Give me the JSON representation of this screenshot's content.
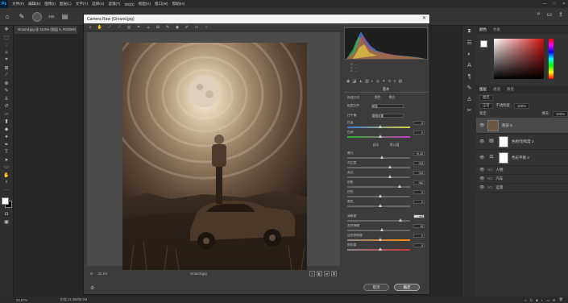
{
  "app": {
    "logo": "Ps"
  },
  "menu": [
    "文件(F)",
    "编辑(E)",
    "图像(I)",
    "图层(L)",
    "文字(Y)",
    "选择(S)",
    "滤镜(T)",
    "3D(D)",
    "视图(V)",
    "窗口(W)",
    "帮助(H)"
  ],
  "options": {
    "brush_size": "495"
  },
  "document": {
    "tab": "Ground.jpg @ 33.6% (图层 5, RGB/8#)"
  },
  "status": {
    "zoom": "33.57%",
    "doc": "文档:14.3M/86.5M"
  },
  "dialog": {
    "title": "Camera Raw (Ground.jpg)",
    "zoom": "31.1%",
    "filename": "Ground.jpg",
    "cancel_label": "取消",
    "ok_label": "确定",
    "basic_label": "基本",
    "white_balance_label": "白平衡:",
    "white_balance_value": "原照设置",
    "temperature_label": "色温",
    "temperature_value": "0",
    "tint_label": "色调",
    "tint_value": "0",
    "auto_label": "自动",
    "default_label": "默认值",
    "exposure_label": "曝光",
    "exposure_value": "+0.29",
    "contrast_label": "对比度",
    "contrast_value": "+33",
    "highlights_label": "高光",
    "highlights_value": "+33",
    "shadows_label": "阴影",
    "shadows_value": "+62",
    "whites_label": "白色",
    "whites_value": "0",
    "blacks_label": "黑色",
    "blacks_value": "0",
    "texture_label": "清晰度",
    "texture_value": "+64",
    "dehaze_label": "去除薄雾",
    "dehaze_value": "+6",
    "vibrance_label": "自然饱和度",
    "vibrance_value": "0",
    "saturation_label": "饱和度",
    "saturation_value": "0",
    "profile_label": "配置文件:",
    "profile_value": "颜色",
    "treatment_label": "处理方式:",
    "treatment_color": "颜色",
    "treatment_bw": "黑白"
  },
  "panels": {
    "color_tab": "颜色",
    "swatch_tab": "色板",
    "layers_tab": "图层",
    "channels_tab": "通道",
    "paths_tab": "路径",
    "blend_mode": "正常",
    "opacity_label": "不透明度:",
    "opacity_value": "100%",
    "lock_label": "锁定:",
    "fill_label": "填充:",
    "fill_value": "100%",
    "search_label": "类型"
  },
  "layers": [
    {
      "name": "图层 5",
      "kind": "pixel",
      "selected": true
    },
    {
      "name": "色相/饱和度 2",
      "kind": "adjust"
    },
    {
      "name": "色彩平衡 3",
      "kind": "adjust"
    },
    {
      "name": "人物",
      "kind": "folder"
    },
    {
      "name": "汽车",
      "kind": "folder"
    },
    {
      "name": "远景",
      "kind": "folder"
    }
  ]
}
